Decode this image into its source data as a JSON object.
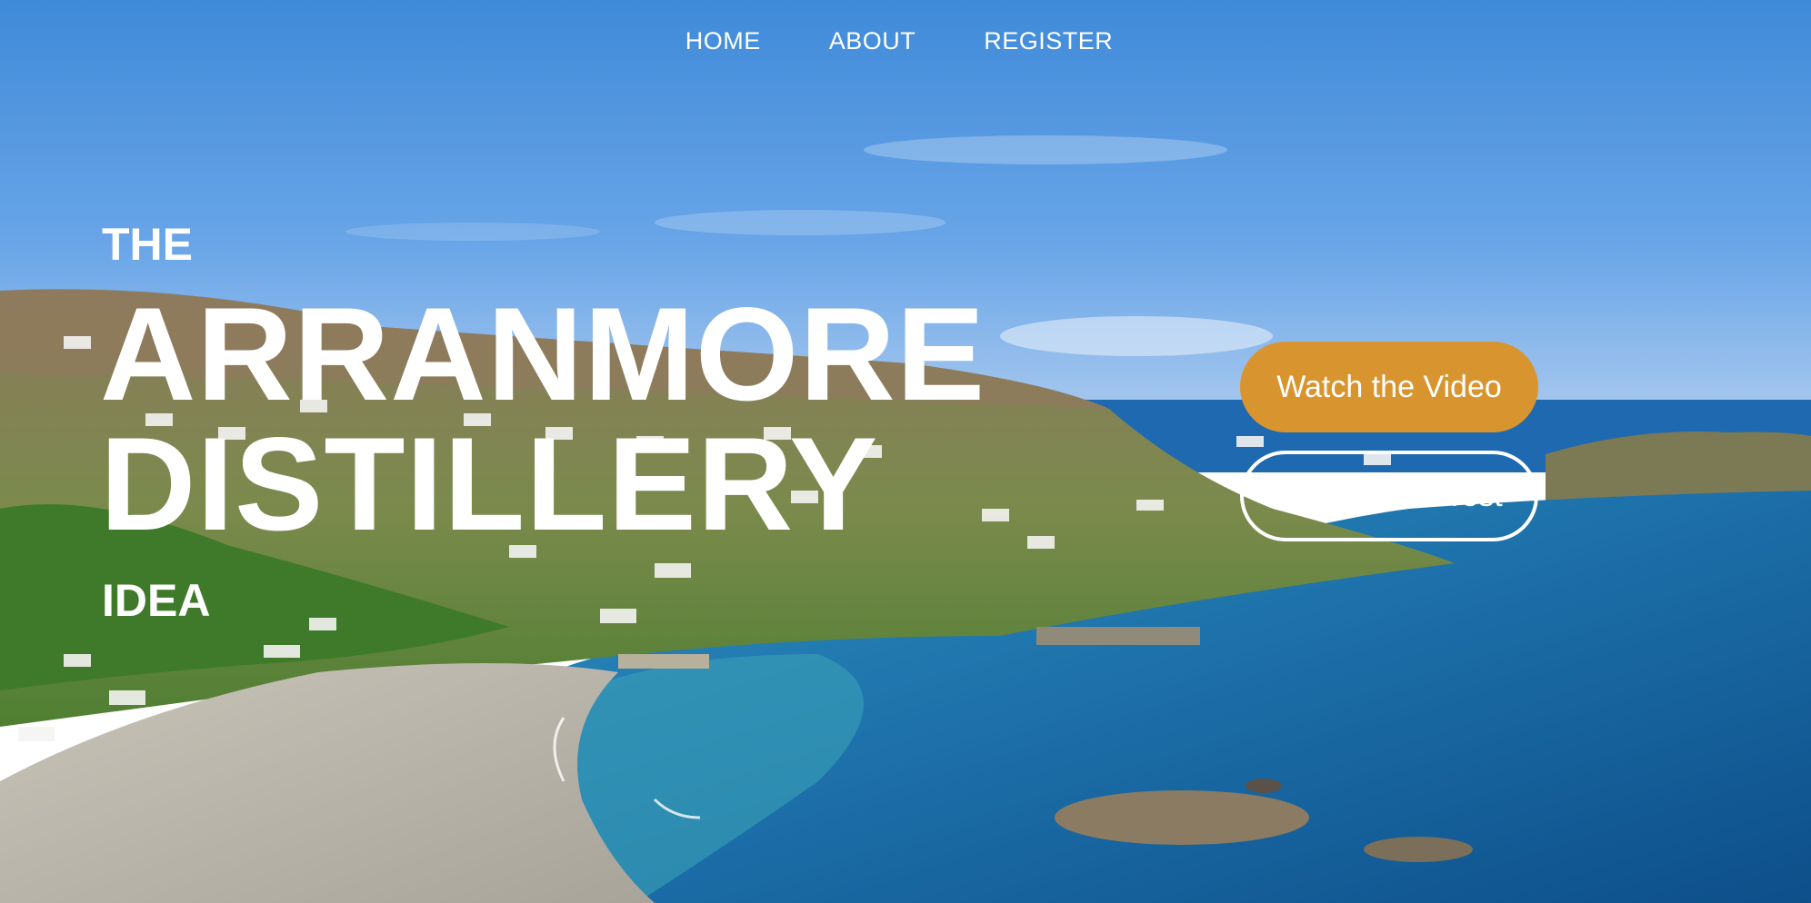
{
  "nav": {
    "items": [
      {
        "label": "HOME"
      },
      {
        "label": "ABOUT"
      },
      {
        "label": "REGISTER"
      }
    ]
  },
  "hero": {
    "kicker": "THE",
    "title_line1": "ARRANMORE",
    "title_line2": "DISTILLERY",
    "subtitle": "IDEA"
  },
  "cta": {
    "watch_label": "Watch the Video",
    "register_label": "Register Interest"
  },
  "colors": {
    "accent": "#d8952f",
    "text": "#ffffff",
    "sky": "#4a90dc",
    "sea": "#1f78b0"
  },
  "background": {
    "description_icon": "coastal-landscape-photo"
  }
}
